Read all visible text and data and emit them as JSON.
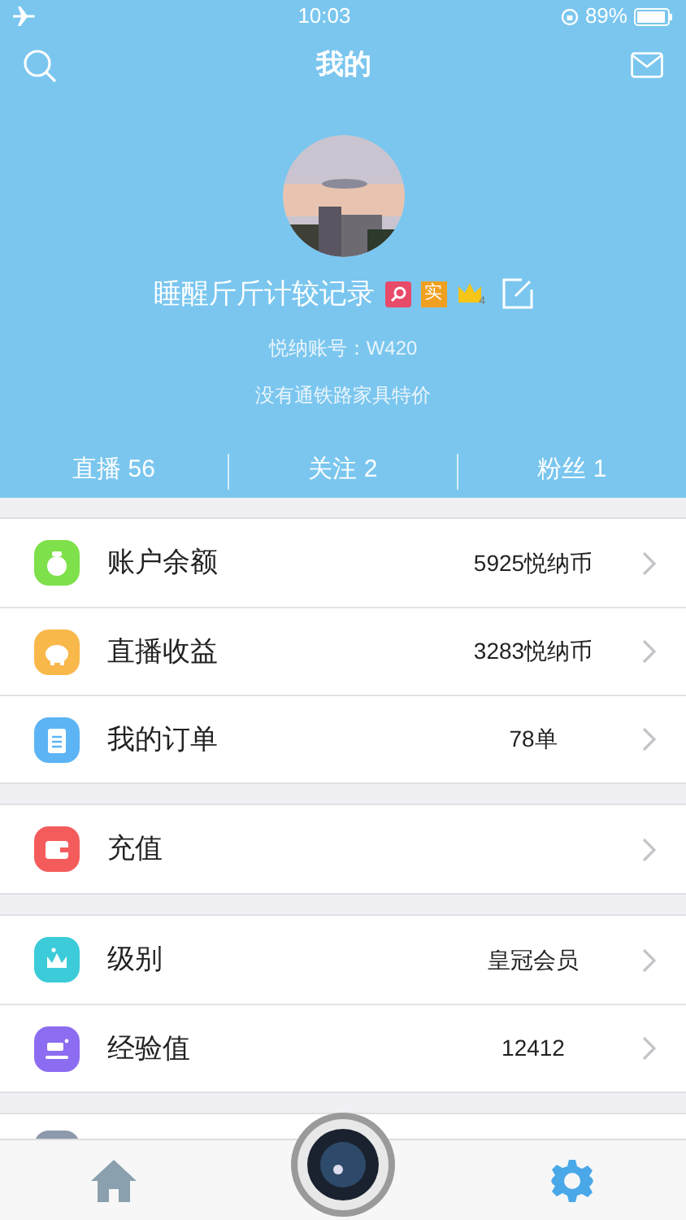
{
  "status_bar": {
    "time": "10:03",
    "battery": "89%"
  },
  "nav": {
    "title": "我的"
  },
  "profile": {
    "name": "睡醒斤斤计较记录",
    "badges": [
      {
        "kind": "search",
        "color": "#e84a6a"
      },
      {
        "kind": "text",
        "text": "实",
        "color": "#f0a020"
      },
      {
        "kind": "crown",
        "text": "4",
        "color": "#f5c518"
      }
    ],
    "account": "悦纳账号：W420",
    "bio": "没有通铁路家具特价"
  },
  "stats": [
    {
      "label": "直播 56"
    },
    {
      "label": "关注 2"
    },
    {
      "label": "粉丝 1"
    }
  ],
  "sections": [
    {
      "rows": [
        {
          "kind": "money",
          "color": "#7ee04a",
          "label": "账户余额",
          "value": "5925悦纳币"
        },
        {
          "kind": "piggy",
          "color": "#f8b84a",
          "label": "直播收益",
          "value": "3283悦纳币"
        },
        {
          "kind": "clipboard",
          "color": "#5cb4f5",
          "label": "我的订单",
          "value": "78单"
        }
      ]
    },
    {
      "rows": [
        {
          "kind": "wallet",
          "color": "#f45c5c",
          "label": "充值"
        }
      ]
    },
    {
      "rows": [
        {
          "kind": "crown",
          "color": "#3ccbd8",
          "label": "级别",
          "value": "皇冠会员"
        },
        {
          "kind": "exp",
          "color": "#8c6cf0",
          "label": "经验值",
          "value": "12412"
        }
      ]
    },
    {
      "rows": [
        {
          "kind": "partial",
          "color": "#8e99ad"
        }
      ]
    }
  ],
  "tab_bar": [
    {
      "kind": "home",
      "selected": false
    },
    {
      "kind": "camera",
      "selected": false
    },
    {
      "kind": "settings",
      "selected": true
    }
  ]
}
